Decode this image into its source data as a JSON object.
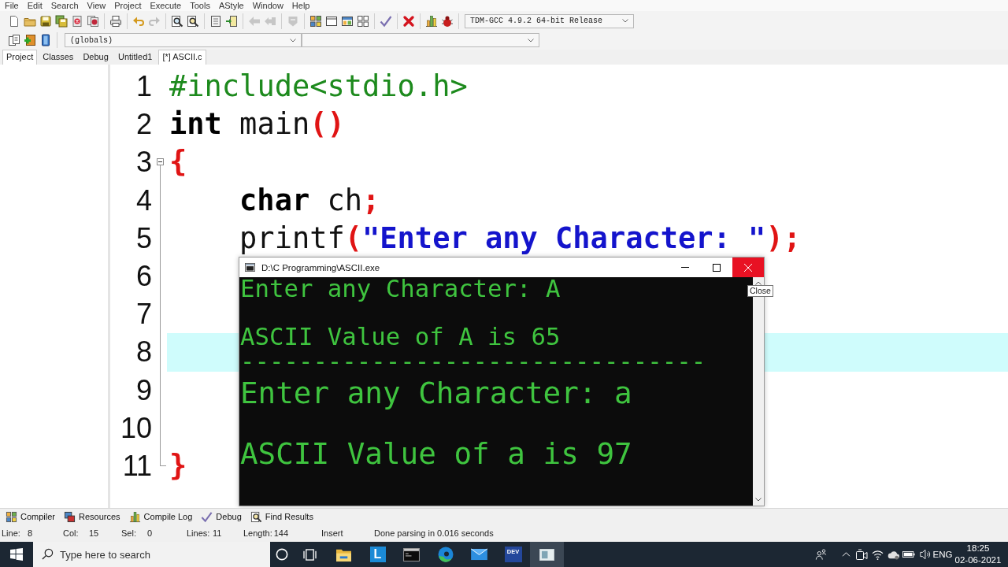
{
  "menu": [
    "File",
    "Edit",
    "Search",
    "View",
    "Project",
    "Execute",
    "Tools",
    "AStyle",
    "Window",
    "Help"
  ],
  "toolbar": {
    "row_1": [
      {
        "buttons": [
          {
            "kind": "new",
            "disabled": false
          },
          {
            "kind": "open",
            "disabled": false
          },
          {
            "kind": "save",
            "disabled": false
          },
          {
            "kind": "save-all",
            "disabled": false
          },
          {
            "kind": "close",
            "disabled": false
          },
          {
            "kind": "close-all",
            "disabled": false
          }
        ]
      },
      {
        "buttons": [
          {
            "kind": "print",
            "disabled": false
          }
        ]
      },
      {
        "buttons": [
          {
            "kind": "undo",
            "disabled": false
          },
          {
            "kind": "redo",
            "disabled": true
          }
        ]
      },
      {
        "buttons": [
          {
            "kind": "find",
            "disabled": false
          },
          {
            "kind": "replace",
            "disabled": false
          }
        ]
      },
      {
        "buttons": [
          {
            "kind": "list",
            "disabled": false
          },
          {
            "kind": "goto",
            "disabled": false
          }
        ]
      },
      {
        "buttons": [
          {
            "kind": "indent",
            "disabled": true
          },
          {
            "kind": "unindent",
            "disabled": true
          }
        ]
      },
      {
        "buttons": [
          {
            "kind": "comment",
            "disabled": true
          }
        ]
      },
      {
        "buttons": [
          {
            "kind": "compile",
            "disabled": false
          },
          {
            "kind": "run",
            "disabled": false
          },
          {
            "kind": "compile-run",
            "disabled": false
          },
          {
            "kind": "rebuild",
            "disabled": false
          }
        ]
      },
      {
        "buttons": [
          {
            "kind": "check",
            "disabled": false
          }
        ]
      },
      {
        "buttons": [
          {
            "kind": "stop",
            "disabled": false
          }
        ]
      },
      {
        "buttons": [
          {
            "kind": "chart",
            "disabled": false
          },
          {
            "kind": "debug",
            "disabled": false
          }
        ]
      }
    ],
    "compiler": "TDM-GCC 4.9.2 64-bit Release",
    "row_2": [
      {
        "buttons": [
          {
            "kind": "new-project",
            "disabled": false
          },
          {
            "kind": "add",
            "disabled": false
          },
          {
            "kind": "book",
            "disabled": false
          }
        ]
      }
    ],
    "scope": "(globals)"
  },
  "side_panel": {
    "tabs": [
      {
        "label": "Project",
        "selected": true
      },
      {
        "label": "Classes",
        "selected": false
      },
      {
        "label": "Debug",
        "selected": false
      }
    ]
  },
  "editor": {
    "tabs": [
      {
        "label": "Untitled1",
        "selected": false
      },
      {
        "label": "[*] ASCII.c",
        "selected": true
      }
    ],
    "lines": [
      {
        "number": "1",
        "kind": "plain",
        "highlighted": false,
        "indented": false,
        "tokens": [
          {
            "kind": "preprocessor",
            "text": "#include<stdio.h>"
          }
        ]
      },
      {
        "number": "2",
        "kind": "plain",
        "highlighted": false,
        "indented": false,
        "tokens": [
          {
            "kind": "keyword",
            "text": "int"
          },
          {
            "kind": "plain",
            "text": " main"
          },
          {
            "kind": "symbol",
            "text": "()"
          }
        ]
      },
      {
        "number": "3",
        "kind": "opener",
        "highlighted": false,
        "indented": false,
        "tokens": [
          {
            "kind": "symbol",
            "text": "{"
          }
        ]
      },
      {
        "number": "4",
        "kind": "inner",
        "highlighted": false,
        "indented": true,
        "tokens": [
          {
            "kind": "keyword",
            "text": "char"
          },
          {
            "kind": "plain",
            "text": " ch"
          },
          {
            "kind": "symbol",
            "text": ";"
          }
        ]
      },
      {
        "number": "5",
        "kind": "inner",
        "highlighted": false,
        "indented": true,
        "tokens": [
          {
            "kind": "plain",
            "text": "printf"
          },
          {
            "kind": "symbol",
            "text": "("
          },
          {
            "kind": "string",
            "text": "\"Enter any Character: \""
          },
          {
            "kind": "symbol",
            "text": ");"
          }
        ]
      },
      {
        "number": "6",
        "kind": "inner",
        "highlighted": false
      },
      {
        "number": "7",
        "kind": "inner",
        "highlighted": false
      },
      {
        "number": "8",
        "kind": "inner",
        "highlighted": true
      },
      {
        "number": "9",
        "kind": "inner",
        "highlighted": false
      },
      {
        "number": "10",
        "kind": "inner",
        "highlighted": false
      },
      {
        "number": "11",
        "kind": "closer",
        "highlighted": false,
        "indented": false,
        "tokens": [
          {
            "kind": "symbol",
            "text": "}"
          }
        ]
      }
    ]
  },
  "console": {
    "title": "D:\\C Programming\\ASCII.exe",
    "close_hovered": true,
    "tooltip": "Close",
    "sections": [
      {
        "lines": [
          {
            "text": "Enter any Character: A",
            "blank_before": false
          },
          {
            "text": "ASCII Value of A is 65",
            "blank_before": true
          },
          {
            "text": "--------------------------------",
            "blank_before": false
          }
        ]
      },
      {
        "lines": [
          {
            "text": "Enter any Character: a",
            "blank_before": false
          },
          {
            "text": "ASCII Value of a is 97",
            "blank_before": true
          }
        ]
      }
    ]
  },
  "bottom_panel": {
    "tabs": [
      {
        "kind": "compile",
        "label": "Compiler",
        "selected": false
      },
      {
        "kind": "resources",
        "label": "Resources",
        "selected": false
      },
      {
        "kind": "chart",
        "label": "Compile Log",
        "selected": false
      },
      {
        "kind": "check",
        "label": "Debug",
        "selected": false
      },
      {
        "kind": "replace",
        "label": "Find Results",
        "selected": false
      }
    ]
  },
  "status_bar": {
    "fields": [
      {
        "label": "Line:",
        "value": "8"
      },
      {
        "label": "Col:",
        "value": "15"
      },
      {
        "label": "Sel:",
        "value": "0"
      },
      {
        "label": "Lines:",
        "value": "11"
      },
      {
        "label": "Length:",
        "value": "144"
      }
    ],
    "mode": "Insert",
    "message": "Done parsing in 0.016 seconds"
  },
  "taskbar": {
    "search": {
      "placeholder": "Type here to search"
    },
    "apps": [
      {
        "kind": "ring",
        "selected": false
      },
      {
        "kind": "task-view",
        "selected": false
      },
      {
        "kind": "folder",
        "selected": false
      },
      {
        "kind": "letter-tile",
        "label": "L",
        "selected": false
      },
      {
        "kind": "terminal",
        "selected": false
      },
      {
        "kind": "swirl",
        "selected": false
      },
      {
        "kind": "envelope",
        "selected": false
      },
      {
        "kind": "dev-tile",
        "label": "DEV",
        "selected": false
      },
      {
        "kind": "window",
        "selected": true
      }
    ],
    "tray": {
      "language": "ENG",
      "time": "18:25",
      "date": "02-06-2021"
    }
  }
}
